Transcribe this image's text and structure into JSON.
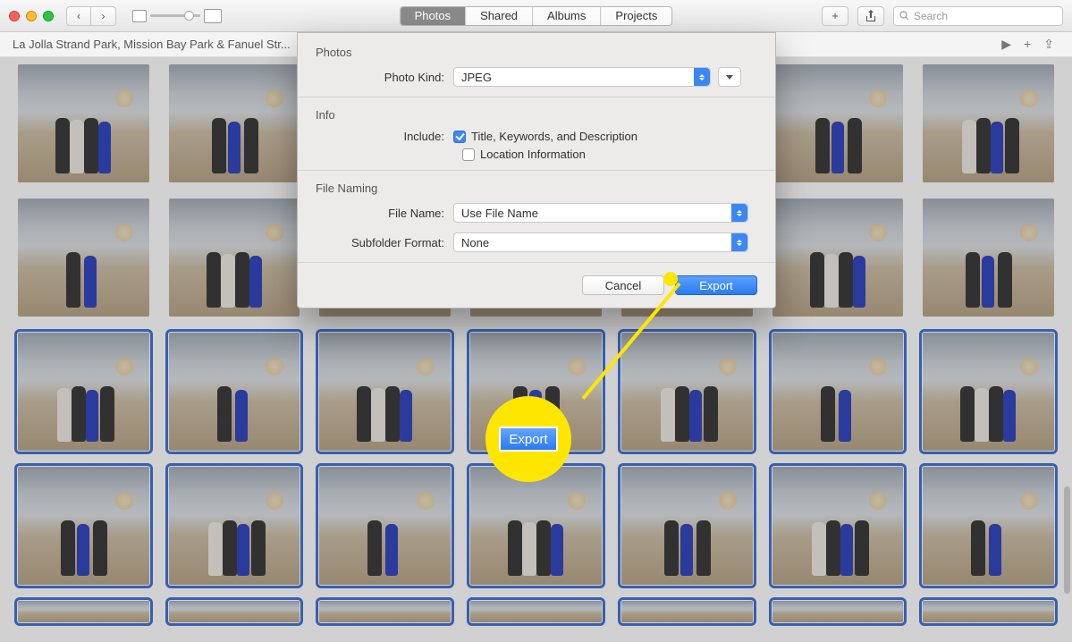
{
  "toolbar": {
    "tabs": [
      "Photos",
      "Shared",
      "Albums",
      "Projects"
    ],
    "active_tab": 0,
    "search_placeholder": "Search"
  },
  "subheader": {
    "title": "La Jolla Strand Park, Mission Bay Park & Fanuel Str..."
  },
  "grid": {
    "rows": [
      {
        "count": 7,
        "selected": false
      },
      {
        "count": 7,
        "selected": false
      },
      {
        "count": 7,
        "selected": true
      },
      {
        "count": 7,
        "selected": true
      },
      {
        "count": 7,
        "selected": true,
        "partial": true
      }
    ]
  },
  "dialog": {
    "sect_photos": "Photos",
    "photo_kind_label": "Photo Kind:",
    "photo_kind_value": "JPEG",
    "sect_info": "Info",
    "include_label": "Include:",
    "include_opt1": "Title, Keywords, and Description",
    "include_opt1_checked": true,
    "include_opt2": "Location Information",
    "include_opt2_checked": false,
    "sect_filenaming": "File Naming",
    "file_name_label": "File Name:",
    "file_name_value": "Use File Name",
    "subfolder_label": "Subfolder Format:",
    "subfolder_value": "None",
    "cancel": "Cancel",
    "export": "Export"
  },
  "annotation": {
    "label": "Export"
  }
}
